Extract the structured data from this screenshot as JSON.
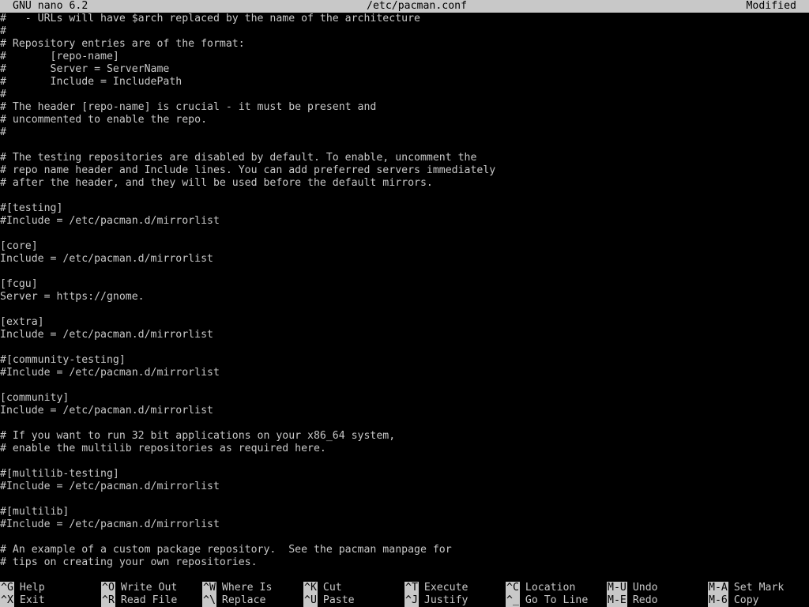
{
  "titlebar": {
    "app": "GNU nano 6.2",
    "filename": "/etc/pacman.conf",
    "status": "Modified"
  },
  "editor": {
    "lines": [
      "#   - URLs will have $arch replaced by the name of the architecture",
      "#",
      "# Repository entries are of the format:",
      "#       [repo-name]",
      "#       Server = ServerName",
      "#       Include = IncludePath",
      "#",
      "# The header [repo-name] is crucial - it must be present and",
      "# uncommented to enable the repo.",
      "#",
      "",
      "# The testing repositories are disabled by default. To enable, uncomment the",
      "# repo name header and Include lines. You can add preferred servers immediately",
      "# after the header, and they will be used before the default mirrors.",
      "",
      "#[testing]",
      "#Include = /etc/pacman.d/mirrorlist",
      "",
      "[core]",
      "Include = /etc/pacman.d/mirrorlist",
      "",
      "[fcgu]",
      "Server = https://gnome.",
      "",
      "[extra]",
      "Include = /etc/pacman.d/mirrorlist",
      "",
      "#[community-testing]",
      "#Include = /etc/pacman.d/mirrorlist",
      "",
      "[community]",
      "Include = /etc/pacman.d/mirrorlist",
      "",
      "# If you want to run 32 bit applications on your x86_64 system,",
      "# enable the multilib repositories as required here.",
      "",
      "#[multilib-testing]",
      "#Include = /etc/pacman.d/mirrorlist",
      "",
      "#[multilib]",
      "#Include = /etc/pacman.d/mirrorlist",
      "",
      "# An example of a custom package repository.  See the pacman manpage for",
      "# tips on creating your own repositories."
    ]
  },
  "shortcuts": {
    "row1": [
      {
        "key": "^G",
        "label": "Help"
      },
      {
        "key": "^O",
        "label": "Write Out"
      },
      {
        "key": "^W",
        "label": "Where Is"
      },
      {
        "key": "^K",
        "label": "Cut"
      },
      {
        "key": "^T",
        "label": "Execute"
      },
      {
        "key": "^C",
        "label": "Location"
      },
      {
        "key": "M-U",
        "label": "Undo"
      },
      {
        "key": "M-A",
        "label": "Set Mark"
      }
    ],
    "row2": [
      {
        "key": "^X",
        "label": "Exit"
      },
      {
        "key": "^R",
        "label": "Read File"
      },
      {
        "key": "^\\",
        "label": "Replace"
      },
      {
        "key": "^U",
        "label": "Paste"
      },
      {
        "key": "^J",
        "label": "Justify"
      },
      {
        "key": "^_",
        "label": "Go To Line"
      },
      {
        "key": "M-E",
        "label": "Redo"
      },
      {
        "key": "M-6",
        "label": "Copy"
      }
    ]
  },
  "colors": {
    "background": "#000000",
    "foreground": "#c8c8c8",
    "inverse_bg": "#c8c8c8",
    "inverse_fg": "#000000"
  }
}
